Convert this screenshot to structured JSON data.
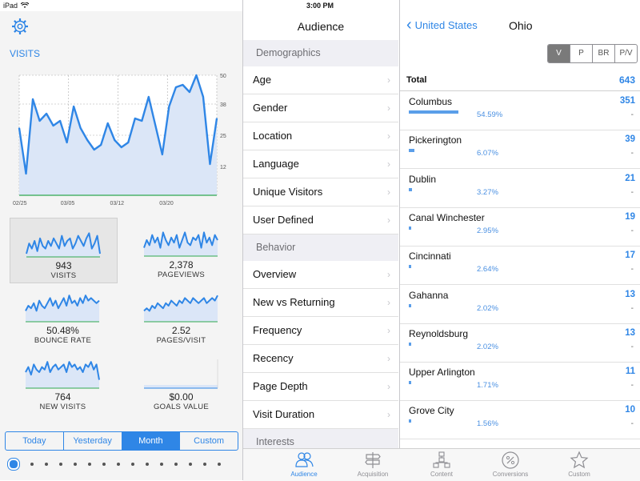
{
  "status": {
    "device": "iPad",
    "time": "3:00 PM"
  },
  "colors": {
    "accent": "#2f86e6",
    "chart_fill": "#dbe6f7",
    "baseline": "#2fa84f"
  },
  "left": {
    "title": "VISITS",
    "sparks": [
      {
        "value": "943",
        "label": "VISITS"
      },
      {
        "value": "2,378",
        "label": "PAGEVIEWS"
      },
      {
        "value": "50.48%",
        "label": "BOUNCE RATE"
      },
      {
        "value": "2.52",
        "label": "PAGES/VISIT"
      },
      {
        "value": "764",
        "label": "NEW VISITS"
      },
      {
        "value": "$0.00",
        "label": "GOALS VALUE"
      }
    ],
    "range_tabs": [
      "Today",
      "Yesterday",
      "Month",
      "Custom"
    ],
    "active_range": "Month"
  },
  "chart_data": {
    "type": "area",
    "title": "VISITS",
    "x_ticks": [
      "02/25",
      "03/05",
      "03/12",
      "03/20"
    ],
    "y_ticks": [
      "50",
      "38",
      "25",
      "12"
    ],
    "ylim": [
      0,
      50
    ],
    "grid": true,
    "values": [
      28,
      9,
      40,
      31,
      34,
      29,
      31,
      22,
      37,
      28,
      23,
      19,
      21,
      30,
      23,
      20,
      22,
      32,
      31,
      41,
      29,
      17,
      37,
      45,
      46,
      43,
      50,
      41,
      13,
      32
    ]
  },
  "middle": {
    "title": "Audience",
    "sections": [
      {
        "header": "Demographics",
        "items": [
          "Age",
          "Gender",
          "Location",
          "Language",
          "Unique Visitors",
          "User Defined"
        ]
      },
      {
        "header": "Behavior",
        "items": [
          "Overview",
          "New vs Returning",
          "Frequency",
          "Recency",
          "Page Depth",
          "Visit Duration"
        ]
      },
      {
        "header": "Interests",
        "items": []
      }
    ]
  },
  "right": {
    "back_label": "United States",
    "title": "Ohio",
    "metric_tabs": [
      "V",
      "P",
      "BR",
      "P/V"
    ],
    "active_metric": "V",
    "total_label": "Total",
    "total_value": "643",
    "cities": [
      {
        "name": "Columbus",
        "count": "351",
        "pct": "54.59%",
        "share": 0.5459,
        "delta": "-"
      },
      {
        "name": "Pickerington",
        "count": "39",
        "pct": "6.07%",
        "share": 0.0607,
        "delta": "-"
      },
      {
        "name": "Dublin",
        "count": "21",
        "pct": "3.27%",
        "share": 0.0327,
        "delta": "-"
      },
      {
        "name": "Canal Winchester",
        "count": "19",
        "pct": "2.95%",
        "share": 0.0295,
        "delta": "-"
      },
      {
        "name": "Cincinnati",
        "count": "17",
        "pct": "2.64%",
        "share": 0.0264,
        "delta": "-"
      },
      {
        "name": "Gahanna",
        "count": "13",
        "pct": "2.02%",
        "share": 0.0202,
        "delta": "-"
      },
      {
        "name": "Reynoldsburg",
        "count": "13",
        "pct": "2.02%",
        "share": 0.0202,
        "delta": "-"
      },
      {
        "name": "Upper Arlington",
        "count": "11",
        "pct": "1.71%",
        "share": 0.0171,
        "delta": "-"
      },
      {
        "name": "Grove City",
        "count": "10",
        "pct": "1.56%",
        "share": 0.0156,
        "delta": "-"
      }
    ]
  },
  "tabbar": {
    "tabs": [
      {
        "label": "Audience",
        "icon": "audience-icon"
      },
      {
        "label": "Acquisition",
        "icon": "signpost-icon"
      },
      {
        "label": "Content",
        "icon": "sitemap-icon"
      },
      {
        "label": "Conversions",
        "icon": "percent-icon"
      },
      {
        "label": "Custom",
        "icon": "star-icon"
      }
    ],
    "active": "Audience"
  }
}
